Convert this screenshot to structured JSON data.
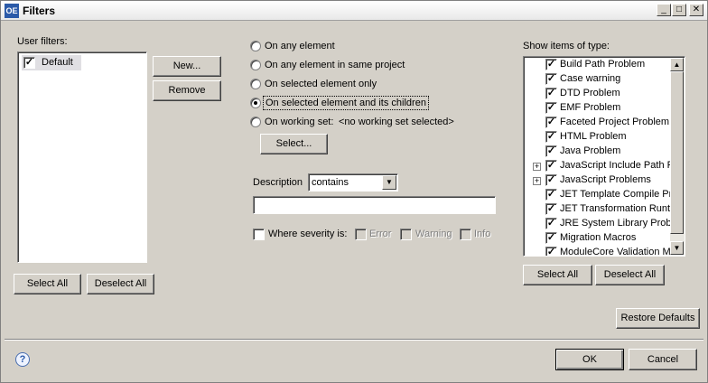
{
  "window": {
    "title": "Filters",
    "app_icon_text": "OE",
    "minimize_glyph": "_",
    "maximize_glyph": "□",
    "close_glyph": "✕"
  },
  "user_filters": {
    "label": "User filters:",
    "items": [
      {
        "label": "Default",
        "checked": true
      }
    ],
    "new_label": "New...",
    "remove_label": "Remove",
    "select_all_label": "Select All",
    "deselect_all_label": "Deselect All"
  },
  "scope": {
    "options": [
      {
        "label": "On any element",
        "selected": false
      },
      {
        "label": "On any element in same project",
        "selected": false
      },
      {
        "label": "On selected element only",
        "selected": false
      },
      {
        "label": "On selected element and its children",
        "selected": true
      },
      {
        "label": "On working set:",
        "selected": false
      }
    ],
    "working_set_value": "<no working set selected>",
    "select_button_label": "Select..."
  },
  "description": {
    "label": "Description",
    "mode": "contains",
    "text": ""
  },
  "severity": {
    "label": "Where severity is:",
    "checked": false,
    "options": [
      {
        "label": "Error",
        "checked": false
      },
      {
        "label": "Warning",
        "checked": false
      },
      {
        "label": "Info",
        "checked": false
      }
    ]
  },
  "types": {
    "label": "Show items of type:",
    "items": [
      {
        "label": "Build Path Problem",
        "checked": true,
        "expandable": false
      },
      {
        "label": "Case warning",
        "checked": true,
        "expandable": false
      },
      {
        "label": "DTD Problem",
        "checked": true,
        "expandable": false
      },
      {
        "label": "EMF Problem",
        "checked": true,
        "expandable": false
      },
      {
        "label": "Faceted Project Problem",
        "checked": true,
        "expandable": false
      },
      {
        "label": "HTML Problem",
        "checked": true,
        "expandable": false
      },
      {
        "label": "Java Problem",
        "checked": true,
        "expandable": false
      },
      {
        "label": "JavaScript Include Path P",
        "checked": true,
        "expandable": true
      },
      {
        "label": "JavaScript Problems",
        "checked": true,
        "expandable": true
      },
      {
        "label": "JET Template Compile Pro",
        "checked": true,
        "expandable": false
      },
      {
        "label": "JET Transformation Runtin",
        "checked": true,
        "expandable": false
      },
      {
        "label": "JRE System Library Proble",
        "checked": true,
        "expandable": false
      },
      {
        "label": "Migration Macros",
        "checked": true,
        "expandable": false
      },
      {
        "label": "ModuleCore Validation Ma",
        "checked": true,
        "expandable": false
      }
    ],
    "select_all_label": "Select All",
    "deselect_all_label": "Deselect All"
  },
  "footer": {
    "restore_defaults_label": "Restore Defaults",
    "ok_label": "OK",
    "cancel_label": "Cancel",
    "help_glyph": "?",
    "check_glyph": "✓",
    "expand_glyph": "+",
    "dropdown_glyph": "▼",
    "scroll_up_glyph": "▲",
    "scroll_down_glyph": "▼"
  }
}
